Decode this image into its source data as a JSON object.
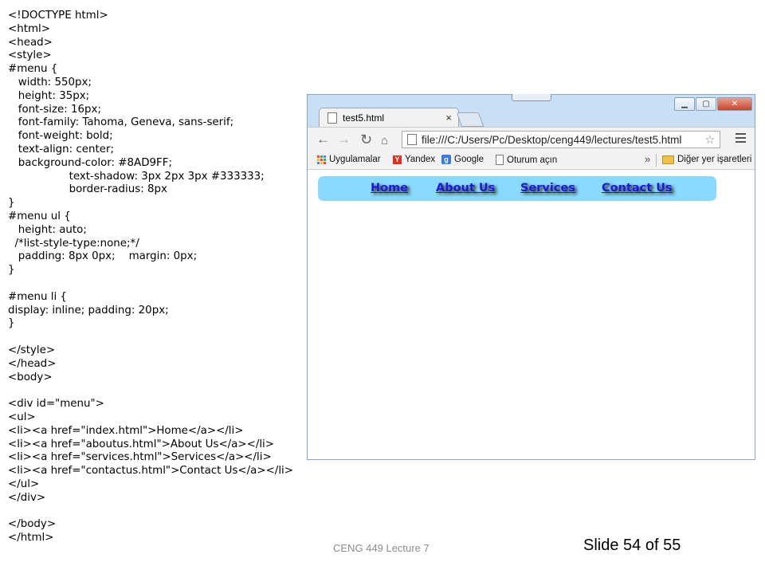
{
  "code_lines": [
    "<!DOCTYPE html>",
    "<html>",
    "<head>",
    "<style>",
    "#menu {",
    "   width: 550px;",
    "   height: 35px;",
    "   font-size: 16px;",
    "   font-family: Tahoma, Geneva, sans-serif;",
    "   font-weight: bold;",
    "   text-align: center;",
    "   background-color: #8AD9FF;",
    "                  text-shadow: 3px 2px 3px #333333;",
    "                  border-radius: 8px",
    "}",
    "#menu ul {",
    "   height: auto;",
    "  /*list-style-type:none;*/",
    "   padding: 8px 0px;    margin: 0px;",
    "}",
    "",
    "#menu li {",
    "display: inline; padding: 20px;",
    "}",
    "",
    "</style>",
    "</head>",
    "<body>",
    "",
    "<div id=\"menu\">",
    "<ul>",
    "<li><a href=\"index.html\">Home</a></li>",
    "<li><a href=\"aboutus.html\">About Us</a></li>",
    "<li><a href=\"services.html\">Services</a></li>",
    "<li><a href=\"contactus.html\">Contact Us</a></li>",
    "</ul>",
    "</div>",
    "",
    "</body>",
    "</html>"
  ],
  "browser": {
    "tab_title": "test5.html",
    "tab_close": "×",
    "url": "file:///C:/Users/Pc/Desktop/ceng449/lectures/test5.html",
    "bookmarks": {
      "apps": "Uygulamalar",
      "yandex": "Yandex",
      "google": "Google",
      "oturum": "Oturum açın",
      "chevron": "»",
      "other": "Diğer yer işaretleri"
    },
    "menu_links": [
      "Home",
      "About Us",
      "Services",
      "Contact Us"
    ],
    "colors": {
      "menu_bg": "#8AD9FF",
      "link": "#1A1BD6"
    }
  },
  "footer": {
    "course": "CENG 449 Lecture 7",
    "slide": "Slide 54 of 55"
  }
}
